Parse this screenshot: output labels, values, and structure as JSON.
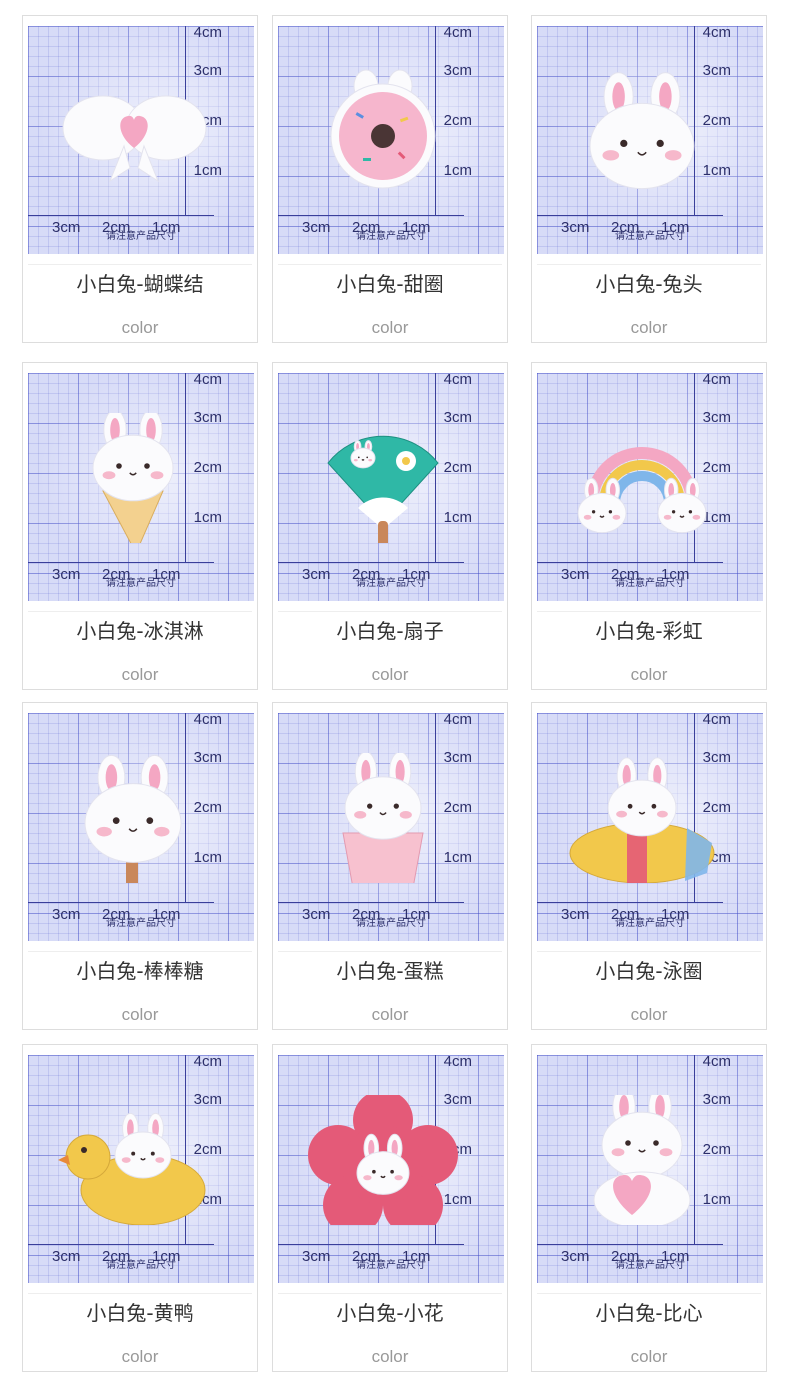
{
  "ruler": {
    "v_labels": [
      "4cm",
      "3cm",
      "2cm",
      "1cm"
    ],
    "h_labels": [
      "3cm",
      "2cm",
      "1cm"
    ],
    "note": "请注意产品尺寸"
  },
  "products": [
    {
      "name": "小白兔-蝴蝶结",
      "option": "color",
      "figure": "bow"
    },
    {
      "name": "小白兔-甜圈",
      "option": "color",
      "figure": "donut"
    },
    {
      "name": "小白兔-兔头",
      "option": "color",
      "figure": "bunny-head"
    },
    {
      "name": "小白兔-冰淇淋",
      "option": "color",
      "figure": "ice-cream"
    },
    {
      "name": "小白兔-扇子",
      "option": "color",
      "figure": "fan"
    },
    {
      "name": "小白兔-彩虹",
      "option": "color",
      "figure": "rainbow"
    },
    {
      "name": "小白兔-棒棒糖",
      "option": "color",
      "figure": "lollipop"
    },
    {
      "name": "小白兔-蛋糕",
      "option": "color",
      "figure": "cupcake"
    },
    {
      "name": "小白兔-泳圈",
      "option": "color",
      "figure": "swim-ring"
    },
    {
      "name": "小白兔-黄鸭",
      "option": "color",
      "figure": "duck"
    },
    {
      "name": "小白兔-小花",
      "option": "color",
      "figure": "flower"
    },
    {
      "name": "小白兔-比心",
      "option": "color",
      "figure": "heart"
    }
  ],
  "colors": {
    "pink": "#f4a7c3",
    "white": "#fbfbfd",
    "cream": "#f3d18f",
    "teal": "#2fb8a6",
    "yellow": "#f2c84b",
    "rose": "#e45a78"
  }
}
